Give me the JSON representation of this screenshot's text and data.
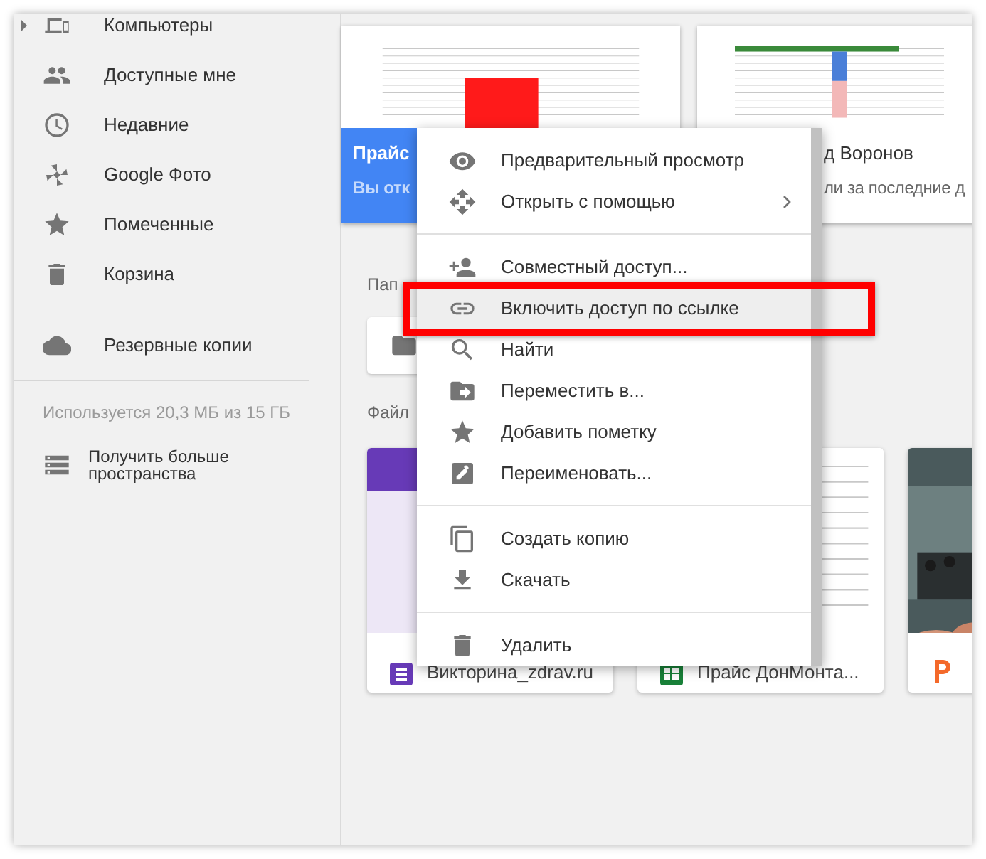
{
  "sidebar": {
    "items": [
      {
        "label": "Компьютеры",
        "expandable": true
      },
      {
        "label": "Доступные мне",
        "expandable": false
      },
      {
        "label": "Недавние",
        "expandable": false
      },
      {
        "label": "Google Фото",
        "expandable": false
      },
      {
        "label": "Помеченные",
        "expandable": false
      },
      {
        "label": "Корзина",
        "expandable": false
      }
    ],
    "backup": "Резервные копии",
    "storage": "Используется 20,3 МБ из 15 ГБ",
    "upgrade": "Получить больше пространства"
  },
  "quick_access": [
    {
      "title": "Прайс",
      "subtitle": "Вы отк",
      "selected": true
    },
    {
      "title": "д Воронов",
      "subtitle": "ли за последние д",
      "selected": false
    }
  ],
  "folders_heading": "Пап",
  "files_heading": "Файл",
  "files": [
    {
      "kind": "form",
      "name": "Викторина_zdrav.ru"
    },
    {
      "kind": "sheet",
      "name": "Прайс ДонМонта..."
    },
    {
      "kind": "slides"
    }
  ],
  "context_menu": {
    "items": [
      {
        "label": "Предварительный просмотр",
        "submenu": false,
        "highlighted": false,
        "divider_before": false
      },
      {
        "label": "Открыть с помощью",
        "submenu": true,
        "highlighted": false,
        "divider_before": false
      },
      {
        "label": "Совместный доступ...",
        "submenu": false,
        "highlighted": false,
        "divider_before": true
      },
      {
        "label": "Включить доступ по ссылке",
        "submenu": false,
        "highlighted": true,
        "divider_before": false
      },
      {
        "label": "Найти",
        "submenu": false,
        "highlighted": false,
        "divider_before": false
      },
      {
        "label": "Переместить в...",
        "submenu": false,
        "highlighted": false,
        "divider_before": false
      },
      {
        "label": "Добавить пометку",
        "submenu": false,
        "highlighted": false,
        "divider_before": false
      },
      {
        "label": "Переименовать...",
        "submenu": false,
        "highlighted": false,
        "divider_before": false
      },
      {
        "label": "Создать копию",
        "submenu": false,
        "highlighted": false,
        "divider_before": true
      },
      {
        "label": "Скачать",
        "submenu": false,
        "highlighted": false,
        "divider_before": false
      },
      {
        "label": "Удалить",
        "submenu": false,
        "highlighted": false,
        "divider_before": true
      }
    ]
  }
}
